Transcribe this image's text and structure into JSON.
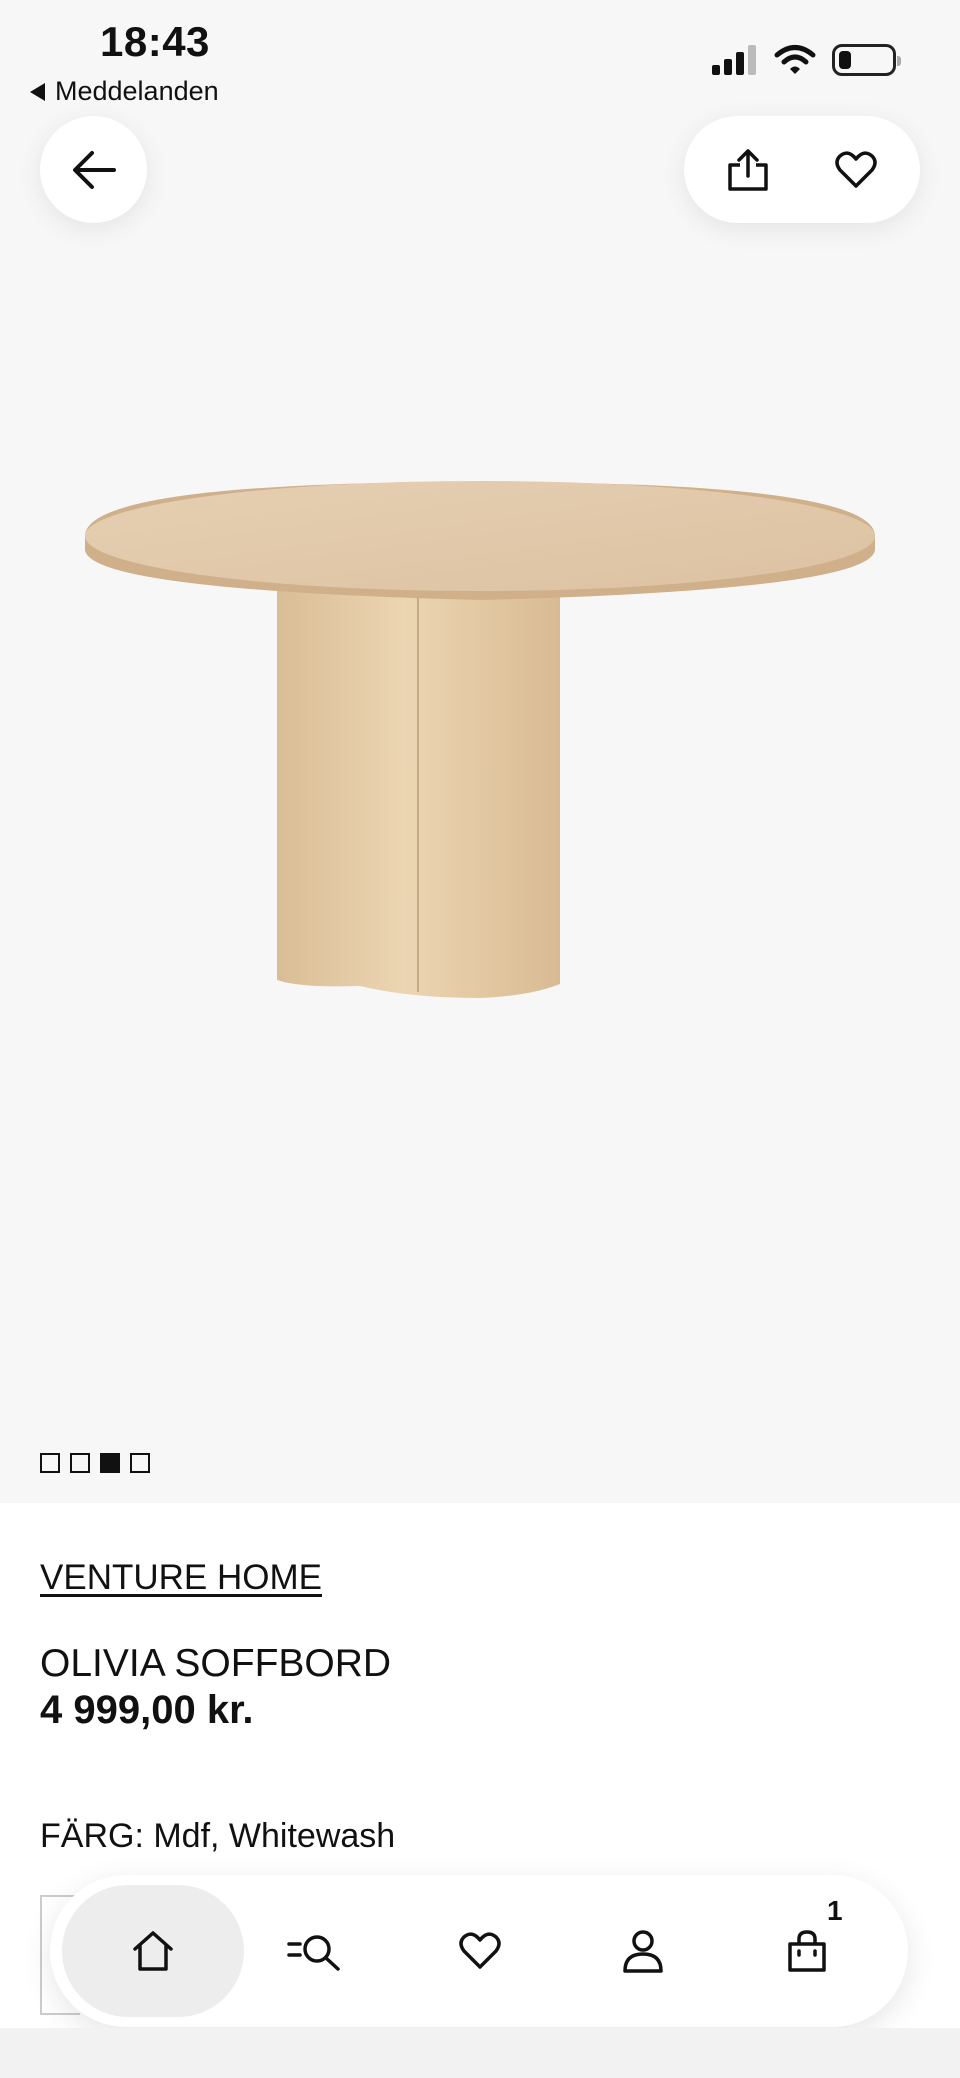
{
  "status_bar": {
    "time": "18:43",
    "back_to_app": "Meddelanden"
  },
  "gallery": {
    "image_count": 4,
    "active_index": 2
  },
  "product": {
    "brand": "VENTURE HOME",
    "name": "OLIVIA SOFFBORD",
    "price": "4 999,00 kr.",
    "color_label": "FÄRG: Mdf, Whitewash"
  },
  "tab_bar": {
    "items": [
      {
        "name": "home",
        "icon": "home-icon"
      },
      {
        "name": "search",
        "icon": "search-icon"
      },
      {
        "name": "favorites",
        "icon": "heart-icon"
      },
      {
        "name": "account",
        "icon": "person-icon"
      },
      {
        "name": "cart",
        "icon": "bag-icon"
      }
    ],
    "cart_count": "1"
  },
  "colors": {
    "background": "#f7f7f7",
    "text": "#111111",
    "wood_top": "#e2c8a8",
    "wood_leg": "#e6cda8"
  }
}
